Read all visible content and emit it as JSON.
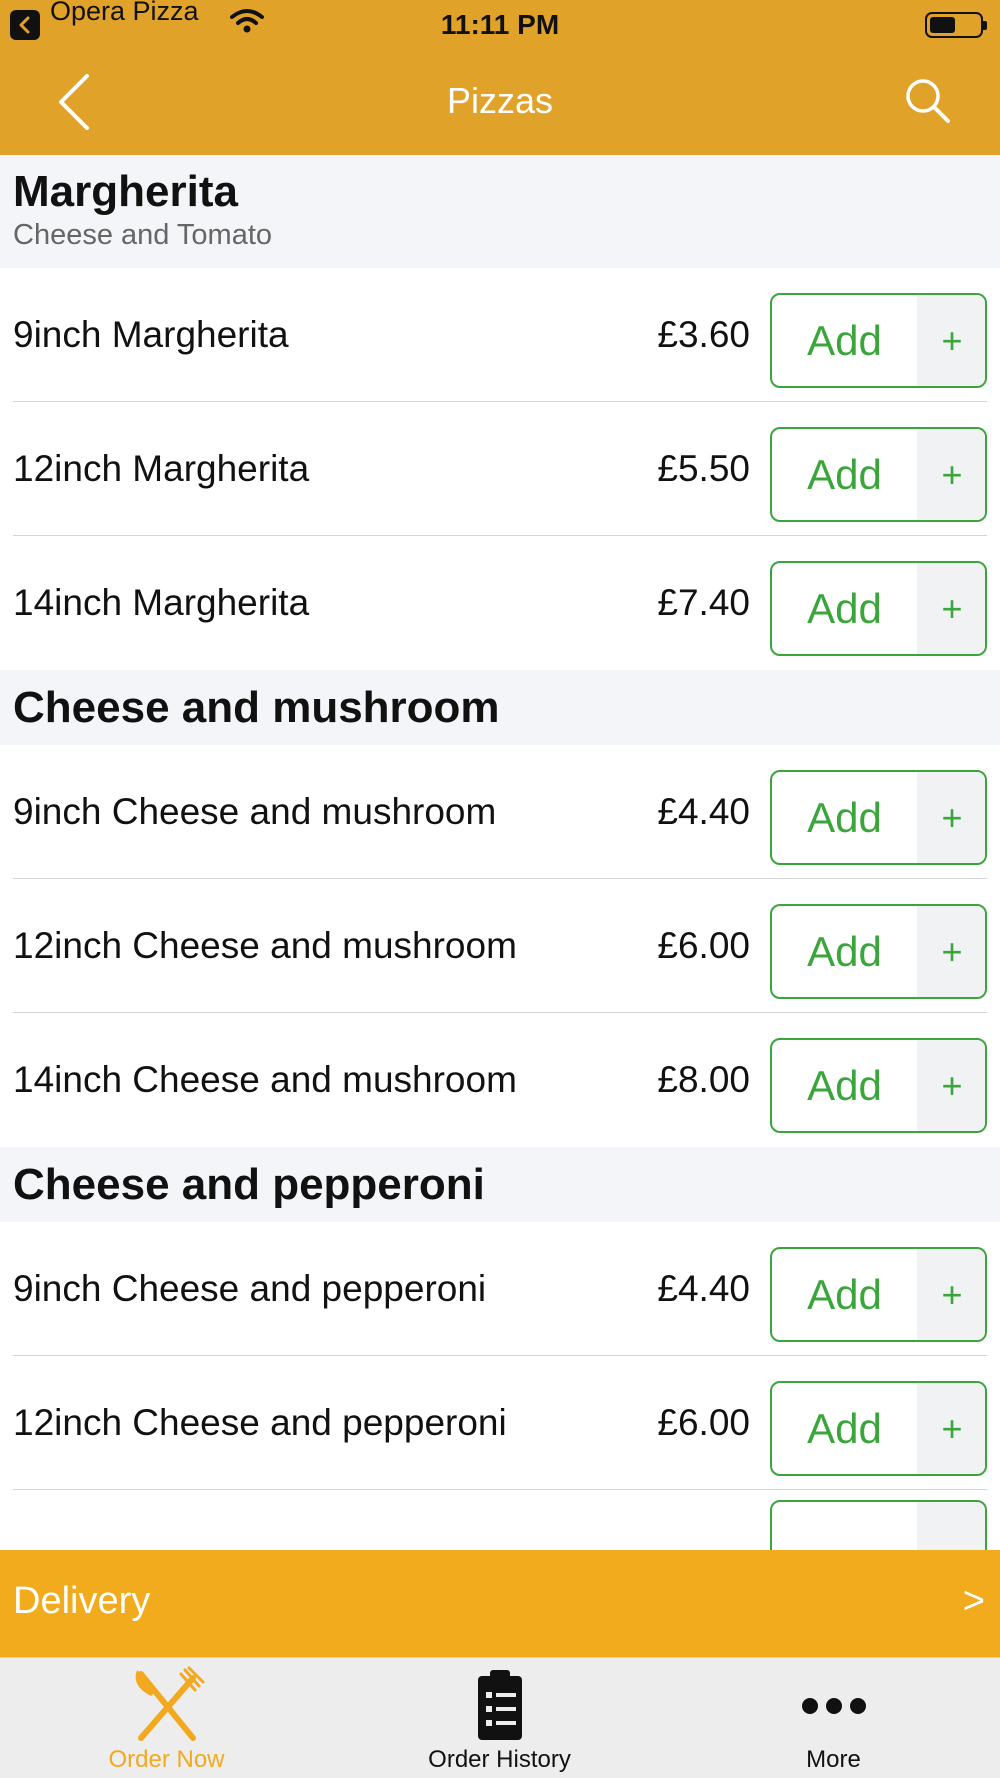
{
  "status_bar": {
    "carrier": "Opera Pizza",
    "time": "11:11 PM",
    "battery_level": 0.5
  },
  "nav": {
    "title": "Pizzas",
    "back_icon": "chevron-left-icon",
    "search_icon": "search-icon"
  },
  "colors": {
    "nav_bar": "#E1A22A",
    "delivery_bar": "#F2AB1C",
    "accent_green": "#3AA53A",
    "active_tab": "#F2A91F"
  },
  "sections": [
    {
      "title": "Margherita",
      "subtitle": "Cheese and Tomato",
      "items": [
        {
          "name": "9inch Margherita",
          "price": "£3.60",
          "add_label": "Add",
          "plus": "+"
        },
        {
          "name": "12inch Margherita",
          "price": "£5.50",
          "add_label": "Add",
          "plus": "+"
        },
        {
          "name": "14inch Margherita",
          "price": "£7.40",
          "add_label": "Add",
          "plus": "+"
        }
      ]
    },
    {
      "title": "Cheese and mushroom",
      "items": [
        {
          "name": "9inch Cheese and mushroom",
          "price": "£4.40",
          "add_label": "Add",
          "plus": "+"
        },
        {
          "name": "12inch Cheese and mushroom",
          "price": "£6.00",
          "add_label": "Add",
          "plus": "+"
        },
        {
          "name": "14inch Cheese and mushroom",
          "price": "£8.00",
          "add_label": "Add",
          "plus": "+"
        }
      ]
    },
    {
      "title": "Cheese and pepperoni",
      "items": [
        {
          "name": "9inch Cheese and pepperoni",
          "price": "£4.40",
          "add_label": "Add",
          "plus": "+"
        },
        {
          "name": "12inch Cheese and pepperoni",
          "price": "£6.00",
          "add_label": "Add",
          "plus": "+"
        }
      ]
    }
  ],
  "delivery": {
    "label": "Delivery",
    "chevron": ">"
  },
  "tabs": [
    {
      "label": "Order Now",
      "icon": "fork-knife-icon",
      "active": true
    },
    {
      "label": "Order History",
      "icon": "clipboard-icon",
      "active": false
    },
    {
      "label": "More",
      "icon": "more-dots-icon",
      "active": false
    }
  ]
}
